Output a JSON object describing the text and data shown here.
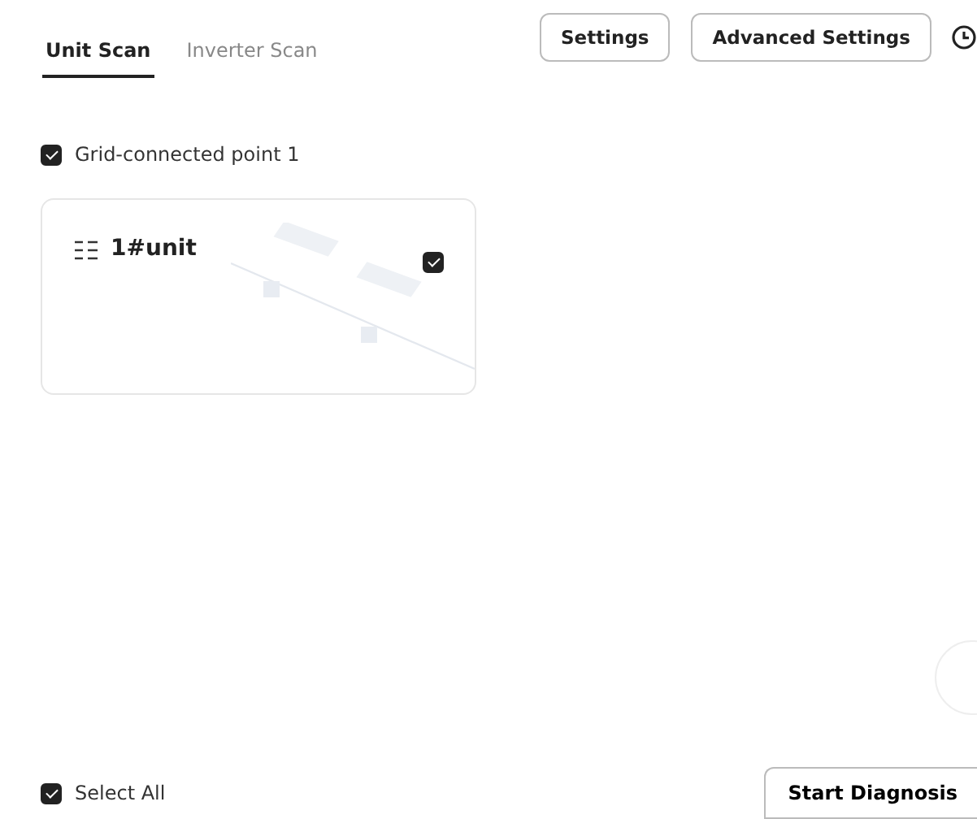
{
  "tabs": [
    {
      "label": "Unit Scan",
      "selected": true
    },
    {
      "label": "Inverter Scan",
      "selected": false
    }
  ],
  "toolbar_buttons": [
    "Settings",
    "Advanced Settings"
  ],
  "group": {
    "label": "Grid-connected point 1",
    "checked": true
  },
  "units": [
    {
      "name": "1#unit",
      "checked": true
    }
  ],
  "footer": {
    "select_all": {
      "label": "Select All",
      "checked": true
    },
    "start_button": "Start Diagnosis"
  }
}
